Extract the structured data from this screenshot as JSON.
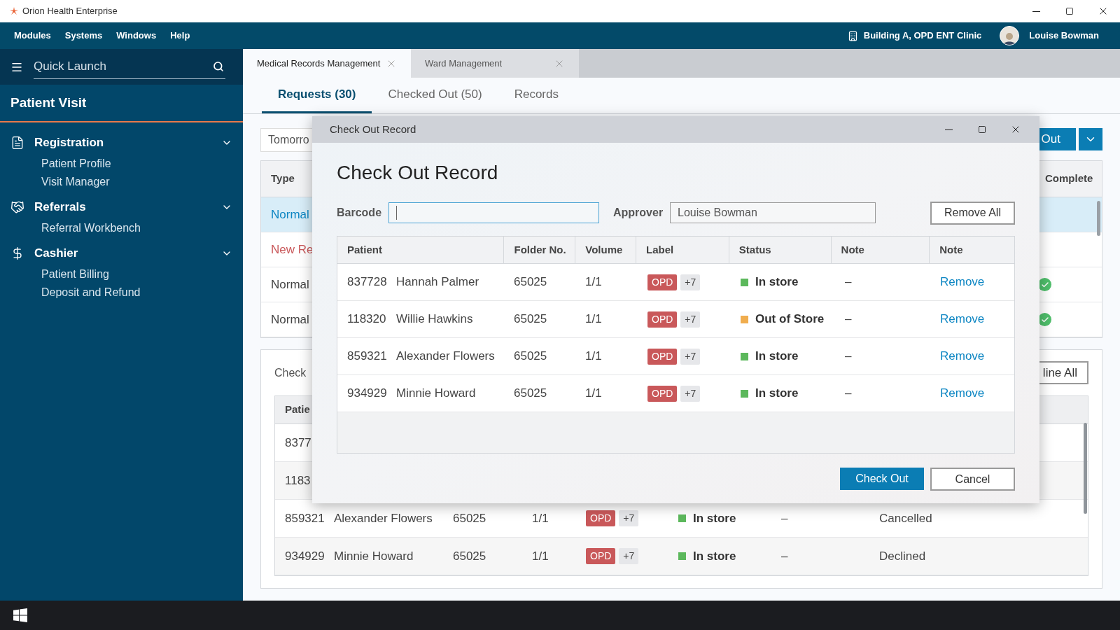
{
  "app_title": "Orion Health Enterprise",
  "menu": [
    "Modules",
    "Systems",
    "Windows",
    "Help"
  ],
  "location": "Building A, OPD ENT Clinic",
  "user": "Louise Bowman",
  "sidebar": {
    "search_placeholder": "Quick Launch",
    "section": "Patient Visit",
    "groups": [
      {
        "label": "Registration",
        "expanded": true,
        "children": [
          {
            "label": "Patient Profile"
          },
          {
            "label": "Visit Manager"
          }
        ]
      },
      {
        "label": "Referrals",
        "expanded": true,
        "children": [
          {
            "label": "Referral Workbench"
          }
        ]
      },
      {
        "label": "Cashier",
        "expanded": true,
        "children": [
          {
            "label": "Patient Billing"
          },
          {
            "label": "Deposit and Refund"
          }
        ]
      }
    ]
  },
  "doc_tabs": [
    {
      "label": "Medical Records Management",
      "selected": true
    },
    {
      "label": "Ward Management",
      "selected": false
    }
  ],
  "sub_tabs": [
    {
      "label": "Requests (30)",
      "selected": true
    },
    {
      "label": "Checked Out (50)",
      "selected": false
    },
    {
      "label": "Records",
      "selected": false
    }
  ],
  "date_field": "Tomorro",
  "out_button": "Out",
  "requests_table": {
    "first_column": "Type",
    "last_column": "Complete",
    "rows": [
      {
        "type": "Normal",
        "kind": "normal",
        "selected": true,
        "complete": false
      },
      {
        "type": "New Re",
        "kind": "new",
        "selected": false,
        "complete": false
      },
      {
        "type": "Normal",
        "kind": "normal",
        "selected": false,
        "complete": true
      },
      {
        "type": "Normal",
        "kind": "normal",
        "selected": false,
        "complete": true
      }
    ]
  },
  "checkout_panel": {
    "label": "Check",
    "decline_button": "line All",
    "table": {
      "first_column": "Patie",
      "rows": [
        {
          "id": "8377"
        },
        {
          "id": "1183"
        },
        {
          "id": "859321",
          "name": "Alexander Flowers",
          "folder": "65025",
          "volume": "1/1",
          "label": "OPD",
          "extra": "+7",
          "status": "In store",
          "color": "#5cb85c",
          "note": "–",
          "state": "Cancelled"
        },
        {
          "id": "934929",
          "name": "Minnie Howard",
          "folder": "65025",
          "volume": "1/1",
          "label": "OPD",
          "extra": "+7",
          "status": "In store",
          "color": "#5cb85c",
          "note": "–",
          "state": "Declined"
        }
      ]
    }
  },
  "dialog": {
    "title": "Check Out Record",
    "heading": "Check Out Record",
    "barcode_label": "Barcode",
    "barcode_focused": true,
    "approver_label": "Approver",
    "approver_value": "Louise Bowman",
    "remove_all": "Remove All",
    "columns": [
      "Patient",
      "Folder No.",
      "Volume",
      "Label",
      "Status",
      "Note",
      "Note"
    ],
    "rows": [
      {
        "id": "837728",
        "name": "Hannah Palmer",
        "folder": "65025",
        "volume": "1/1",
        "label": "OPD",
        "extra": "+7",
        "status": "In store",
        "color": "#5cb85c",
        "note": "–",
        "action": "Remove"
      },
      {
        "id": "118320",
        "name": "Willie Hawkins",
        "folder": "65025",
        "volume": "1/1",
        "label": "OPD",
        "extra": "+7",
        "status": "Out of Store",
        "color": "#f0ad4e",
        "note": "–",
        "action": "Remove"
      },
      {
        "id": "859321",
        "name": "Alexander Flowers",
        "folder": "65025",
        "volume": "1/1",
        "label": "OPD",
        "extra": "+7",
        "status": "In store",
        "color": "#5cb85c",
        "note": "–",
        "action": "Remove"
      },
      {
        "id": "934929",
        "name": "Minnie Howard",
        "folder": "65025",
        "volume": "1/1",
        "label": "OPD",
        "extra": "+7",
        "status": "In store",
        "color": "#5cb85c",
        "note": "–",
        "action": "Remove"
      }
    ],
    "confirm_button": "Check Out",
    "cancel_button": "Cancel"
  }
}
